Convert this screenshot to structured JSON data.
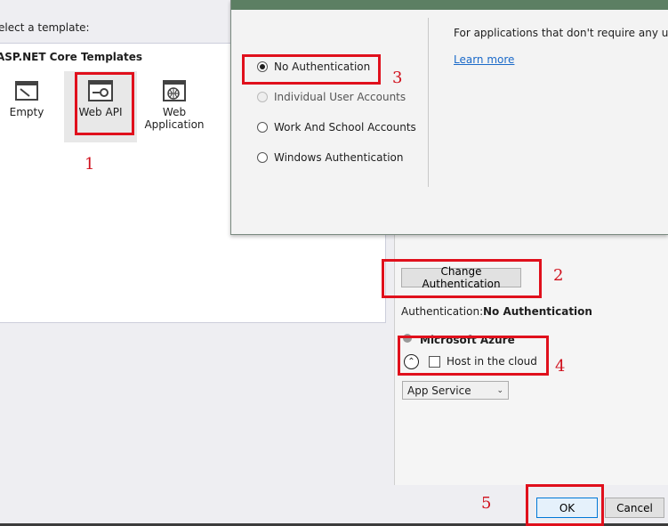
{
  "template_picker": {
    "select_label": "elect a template:",
    "group_heading": "ASP.NET Core Templates",
    "templates": [
      {
        "label": "Empty",
        "icon": "empty-template-icon"
      },
      {
        "label": "Web API",
        "icon": "web-api-template-icon"
      },
      {
        "label_line1": "Web",
        "label_line2": "Application",
        "icon": "web-application-template-icon"
      }
    ]
  },
  "auth_dialog": {
    "options": [
      {
        "label": "No Authentication",
        "selected": true,
        "enabled": true
      },
      {
        "label": "Individual User Accounts",
        "selected": false,
        "enabled": false
      },
      {
        "label": "Work And School Accounts",
        "selected": false,
        "enabled": true
      },
      {
        "label": "Windows Authentication",
        "selected": false,
        "enabled": true
      }
    ],
    "description": "For applications that don't require any user au",
    "learn_more": "Learn more"
  },
  "right_panel": {
    "change_auth_button": "Change Authentication",
    "auth_label": "Authentication:",
    "auth_value": "No Authentication",
    "azure_label": "Microsoft Azure",
    "host_in_cloud_label": "Host in the cloud",
    "host_in_cloud_checked": false,
    "app_service_selected": "App Service"
  },
  "footer": {
    "ok_label": "OK",
    "cancel_label": "Cancel"
  },
  "annotations": {
    "n1": "1",
    "n2": "2",
    "n3": "3",
    "n4": "4",
    "n5": "5",
    "color": "#e0101c"
  }
}
